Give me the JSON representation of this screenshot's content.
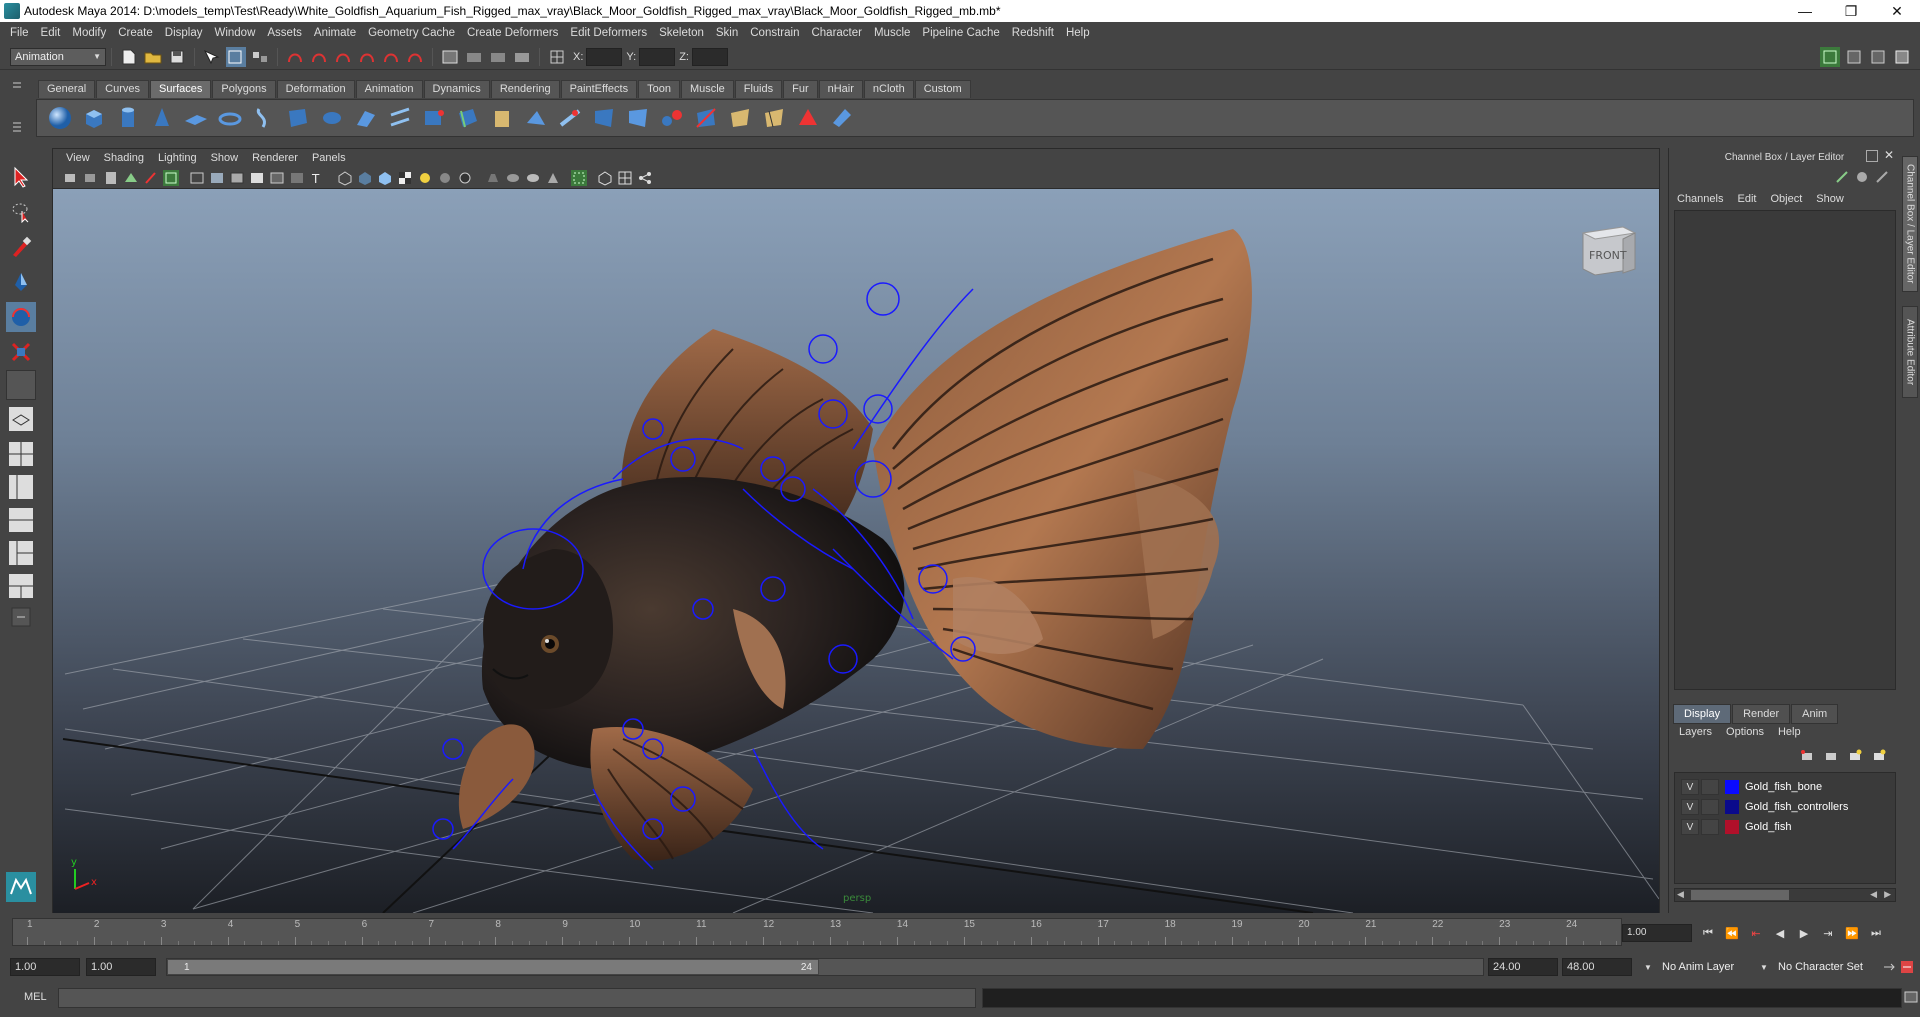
{
  "window": {
    "title": "Autodesk Maya 2014: D:\\models_temp\\Test\\Ready\\White_Goldfish_Aquarium_Fish_Rigged_max_vray\\Black_Moor_Goldfish_Rigged_max_vray\\Black_Moor_Goldfish_Rigged_mb.mb*",
    "minimize": "—",
    "restore": "❐",
    "close": "✕"
  },
  "menubar": [
    "File",
    "Edit",
    "Modify",
    "Create",
    "Display",
    "Window",
    "Assets",
    "Animate",
    "Geometry Cache",
    "Create Deformers",
    "Edit Deformers",
    "Skeleton",
    "Skin",
    "Constrain",
    "Character",
    "Muscle",
    "Pipeline Cache",
    "Redshift",
    "Help"
  ],
  "statusline": {
    "menuset": "Animation",
    "x_label": "X:",
    "y_label": "Y:",
    "z_label": "Z:"
  },
  "shelf": {
    "tabs": [
      "General",
      "Curves",
      "Surfaces",
      "Polygons",
      "Deformation",
      "Animation",
      "Dynamics",
      "Rendering",
      "PaintEffects",
      "Toon",
      "Muscle",
      "Fluids",
      "Fur",
      "nHair",
      "nCloth",
      "Custom"
    ],
    "active_tab": "Surfaces"
  },
  "viewport": {
    "menu": [
      "View",
      "Shading",
      "Lighting",
      "Show",
      "Renderer",
      "Panels"
    ],
    "viewcube_label": "FRONT",
    "camera_label": "persp",
    "axis_x": "x",
    "axis_y": "y"
  },
  "channelbox": {
    "title": "Channel Box / Layer Editor",
    "menu": [
      "Channels",
      "Edit",
      "Object",
      "Show"
    ],
    "layer_tabs": [
      "Display",
      "Render",
      "Anim"
    ],
    "active_layer_tab": "Display",
    "layer_menu": [
      "Layers",
      "Options",
      "Help"
    ],
    "layers": [
      {
        "visible": "V",
        "name": "Gold_fish_bone",
        "color": "#0a0aff"
      },
      {
        "visible": "V",
        "name": "Gold_fish_controllers",
        "color": "#0a0a8c"
      },
      {
        "visible": "V",
        "name": "Gold_fish",
        "color": "#b0102a"
      }
    ]
  },
  "vertical_tabs": [
    "Channel Box / Layer Editor",
    "Attribute Editor"
  ],
  "timeslider": {
    "ticks": [
      "1",
      "2",
      "3",
      "4",
      "5",
      "6",
      "7",
      "8",
      "9",
      "10",
      "11",
      "12",
      "13",
      "14",
      "15",
      "16",
      "17",
      "18",
      "19",
      "20",
      "21",
      "22",
      "23",
      "24"
    ],
    "current_time": "1.00"
  },
  "rangeslider": {
    "start_time": "1.00",
    "playback_start": "1.00",
    "range_start_label": "1",
    "range_end_label": "24",
    "playback_end": "24.00",
    "end_time": "48.00",
    "anim_layer": "No Anim Layer",
    "character_set": "No Character Set"
  },
  "cmdline": {
    "label": "MEL"
  },
  "colors": {
    "ui_bg": "#444444",
    "active_tab": "#6b6b6b",
    "rig_blue": "#1a1aff"
  }
}
